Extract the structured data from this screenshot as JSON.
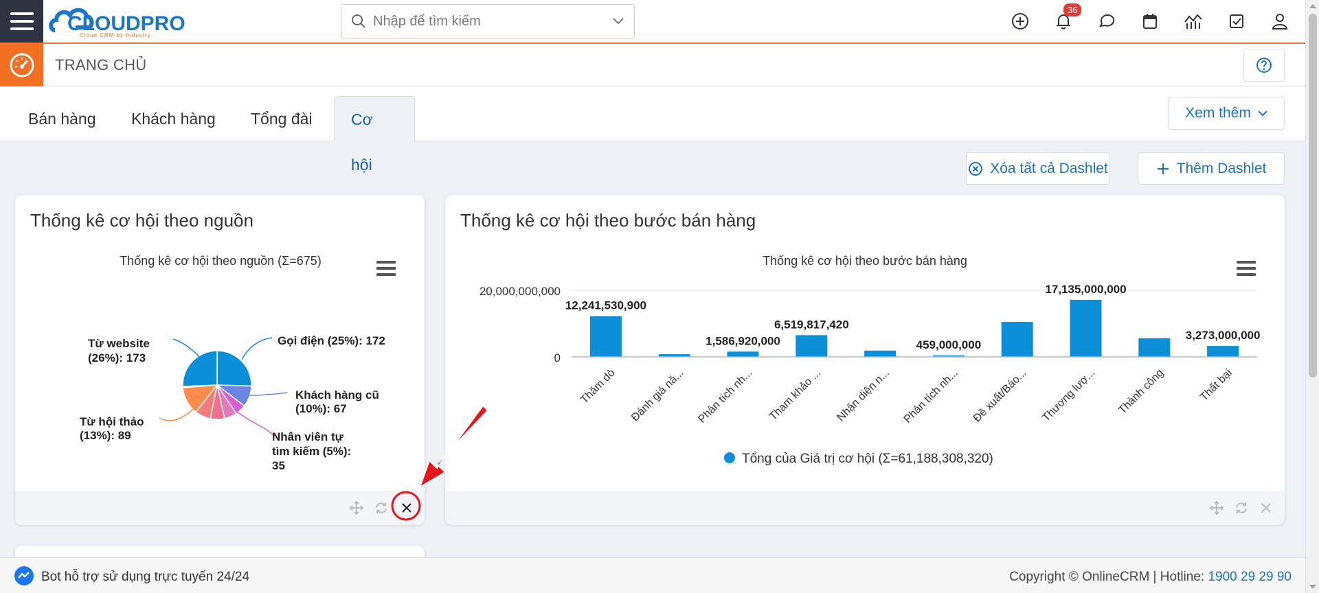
{
  "brand": {
    "logo_text": "CLOUDPRO",
    "logo_tagline": "Cloud CRM by Industry",
    "accent": "#f36f21",
    "primary": "#1a73c8",
    "logo_blue": "#1877c8"
  },
  "header": {
    "search_placeholder": "Nhập để tìm kiếm",
    "notification_count": "36",
    "icons": [
      "plus-circle-icon",
      "bell-icon",
      "chat-icon",
      "calendar-icon",
      "report-chart-icon",
      "task-check-icon",
      "user-icon"
    ]
  },
  "page": {
    "title": "TRANG CHỦ",
    "home_icon": "speedometer-icon",
    "help_icon": "question-icon"
  },
  "tabs": [
    {
      "label": "Bán hàng",
      "active": false
    },
    {
      "label": "Khách hàng",
      "active": false
    },
    {
      "label": "Tổng đài",
      "active": false
    },
    {
      "label": "Cơ hội",
      "active": true
    }
  ],
  "more_button": "Xem thêm",
  "actions": {
    "clear_all": "Xóa tất cả Dashlet",
    "add": "Thêm Dashlet"
  },
  "dashlets": [
    {
      "title": "Thống kê cơ hội theo nguồn",
      "chart_data": {
        "type": "pie",
        "title": "Thống kê cơ hội theo nguồn (Σ=675)",
        "slices": [
          {
            "label": "Gọi điện",
            "percent": "25%",
            "value": 172,
            "color": "#0a8fd8"
          },
          {
            "label": "Khách hàng cũ",
            "percent": "10%",
            "value": 67,
            "color": "#6b85e6"
          },
          {
            "label": "Nhân viên tự tìm kiếm",
            "percent": "5%",
            "value": 35,
            "color": "#d85fd8"
          },
          {
            "label": "",
            "percent": "",
            "value": 40,
            "color": "#e07ab8"
          },
          {
            "label": "",
            "percent": "",
            "value": 45,
            "color": "#f06e8e"
          },
          {
            "label": "",
            "percent": "",
            "value": 50,
            "color": "#f27c78"
          },
          {
            "label": "Từ hội thảo",
            "percent": "13%",
            "value": 89,
            "color": "#ff8c4a"
          },
          {
            "label": "",
            "percent": "",
            "value": 4,
            "color": "#f7c23a"
          },
          {
            "label": "Từ website",
            "percent": "26%",
            "value": 173,
            "color": "#0a8fd8"
          }
        ],
        "labels": [
          {
            "lines": [
              "Gọi điện (25%): 172"
            ]
          },
          {
            "lines": [
              "Khách hàng cũ",
              "(10%): 67"
            ]
          },
          {
            "lines": [
              "Nhân viên tự",
              "tìm kiếm (5%):",
              "35"
            ]
          },
          {
            "lines": [
              "Từ hội thảo",
              "(13%): 89"
            ]
          },
          {
            "lines": [
              "Từ website",
              "(26%): 173"
            ]
          }
        ]
      }
    },
    {
      "title": "Thống kê cơ hội theo bước bán hàng",
      "chart_data": {
        "type": "bar",
        "title": "Thống kê cơ hội theo bước bán hàng",
        "categories": [
          "Thăm dò",
          "Đánh giá nă...",
          "Phân tích nh...",
          "Tham khảo ...",
          "Nhận diện n...",
          "Phân tích nh...",
          "Đề xuất/Báo...",
          "Thương lượ...",
          "Thành công",
          "Thất bại"
        ],
        "values": [
          12241530900,
          800000000,
          1586920000,
          6519817420,
          1900000000,
          459000000,
          10500000000,
          17135000000,
          5600000000,
          3273000000
        ],
        "data_labels": [
          "12,241,530,900",
          "",
          "1,586,920,000",
          "6,519,817,420",
          "",
          "459,000,000",
          "",
          "17,135,000,000",
          "",
          "3,273,000,000"
        ],
        "ylim": [
          0,
          20000000000
        ],
        "y_ticks": [
          "20,000,000,000",
          "0"
        ],
        "series_name": "Tổng của Giá trị cơ hội (Σ=61,188,308,320)",
        "color": "#0a8fd8"
      }
    }
  ],
  "bottom": {
    "bot_text": "Bot hỗ trợ sử dụng trực tuyến 24/24",
    "copyright": "Copyright © OnlineCRM",
    "hotline_label": "Hotline:",
    "hotline_number": "1900 29 29 90"
  }
}
